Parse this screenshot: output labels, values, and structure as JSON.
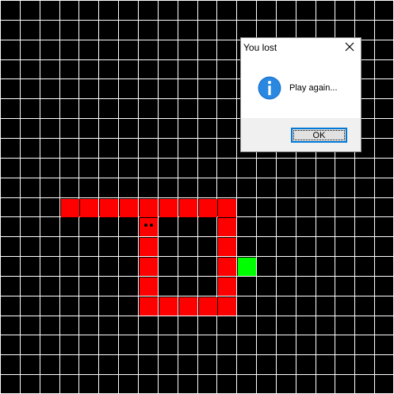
{
  "game": {
    "grid_cols": 20,
    "grid_rows": 20,
    "colors": {
      "background": "#000000",
      "grid": "#ffffff",
      "snake": "#ff0000",
      "food": "#00ff00"
    },
    "snake_head": [
      7,
      11
    ],
    "snake_body": [
      [
        3,
        10
      ],
      [
        4,
        10
      ],
      [
        5,
        10
      ],
      [
        6,
        10
      ],
      [
        7,
        10
      ],
      [
        8,
        10
      ],
      [
        9,
        10
      ],
      [
        10,
        10
      ],
      [
        11,
        10
      ],
      [
        11,
        11
      ],
      [
        11,
        12
      ],
      [
        11,
        13
      ],
      [
        11,
        14
      ],
      [
        11,
        15
      ],
      [
        10,
        15
      ],
      [
        9,
        15
      ],
      [
        8,
        15
      ],
      [
        7,
        15
      ],
      [
        7,
        14
      ],
      [
        7,
        13
      ],
      [
        7,
        12
      ],
      [
        7,
        11
      ]
    ],
    "food": [
      12,
      13
    ]
  },
  "dialog": {
    "title": "You lost",
    "message": "Play again...",
    "ok_label": "OK",
    "icon": "info-icon",
    "close_icon": "close-icon"
  }
}
